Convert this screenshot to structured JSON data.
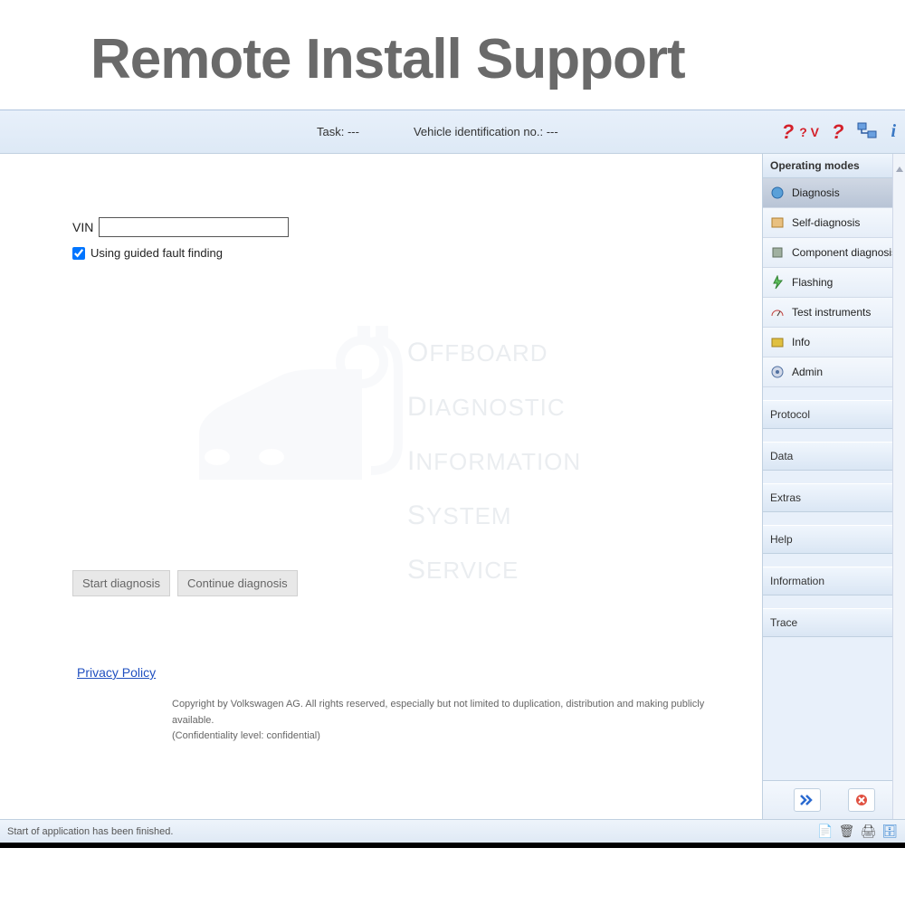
{
  "heading": "Remote Install Support",
  "topbar": {
    "task_label": "Task:",
    "task_value": "---",
    "vin_label": "Vehicle identification no.:",
    "vin_value": "---",
    "voltage_text": "? V"
  },
  "main": {
    "vin_field_label": "VIN",
    "vin_field_value": "",
    "guided_checkbox_label": "Using guided fault finding",
    "guided_checked": true,
    "watermark_lines": [
      "OFFBOARD",
      "DIAGNOSTIC",
      "INFORMATION",
      "SYSTEM",
      "SERVICE"
    ],
    "start_button": "Start diagnosis",
    "continue_button": "Continue diagnosis",
    "privacy_link": "Privacy Policy",
    "copyright_line1": "Copyright by Volkswagen AG. All rights reserved, especially but not limited to duplication, distribution and making publicly available.",
    "copyright_line2": "(Confidentiality level: confidential)"
  },
  "sidebar": {
    "operating_modes_title": "Operating modes",
    "modes": [
      {
        "label": "Diagnosis",
        "icon": "diag",
        "active": true
      },
      {
        "label": "Self-diagnosis",
        "icon": "self",
        "active": false
      },
      {
        "label": "Component diagnosis",
        "icon": "comp",
        "active": false
      },
      {
        "label": "Flashing",
        "icon": "flash",
        "active": false
      },
      {
        "label": "Test instruments",
        "icon": "test",
        "active": false
      },
      {
        "label": "Info",
        "icon": "info",
        "active": false
      },
      {
        "label": "Admin",
        "icon": "admin",
        "active": false
      }
    ],
    "collapsed_panels": [
      "Protocol",
      "Data",
      "Extras",
      "Help",
      "Information",
      "Trace"
    ]
  },
  "statusbar": {
    "message": "Start of application has been finished."
  }
}
